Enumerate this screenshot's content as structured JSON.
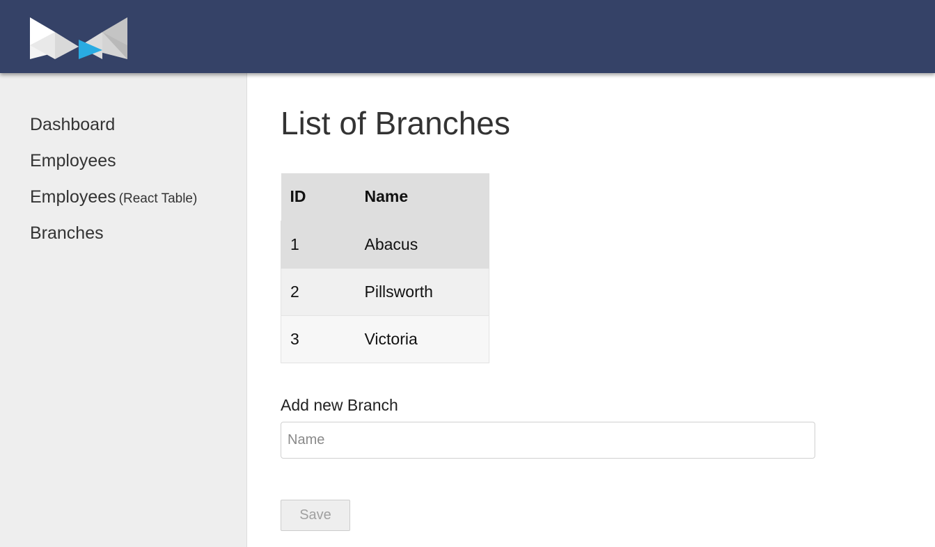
{
  "sidebar": {
    "items": [
      {
        "label": "Dashboard",
        "suffix": ""
      },
      {
        "label": "Employees",
        "suffix": ""
      },
      {
        "label": "Employees",
        "suffix": "(React Table)"
      },
      {
        "label": "Branches",
        "suffix": ""
      }
    ]
  },
  "main": {
    "title": "List of Branches",
    "table": {
      "headers": {
        "id": "ID",
        "name": "Name"
      },
      "rows": [
        {
          "id": "1",
          "name": "Abacus"
        },
        {
          "id": "2",
          "name": "Pillsworth"
        },
        {
          "id": "3",
          "name": "Victoria"
        }
      ]
    },
    "form": {
      "label": "Add new Branch",
      "name_placeholder": "Name",
      "name_value": "",
      "save_label": "Save",
      "save_disabled": true
    }
  },
  "colors": {
    "header_bg": "#354267",
    "sidebar_bg": "#eeeeee",
    "logo_accent": "#29abe2"
  },
  "icons": {
    "logo": "bowtie-logo-icon"
  }
}
